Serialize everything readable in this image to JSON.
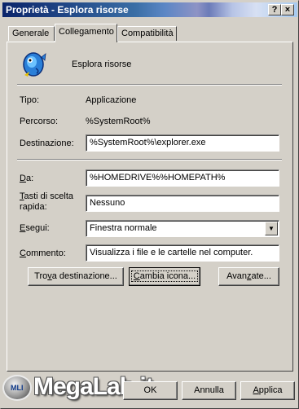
{
  "window": {
    "title": "Proprietà - Esplora risorse",
    "help_button": "?",
    "close_button": "×"
  },
  "tabs": [
    {
      "label": "Generale"
    },
    {
      "label": "Collegamento"
    },
    {
      "label": "Compatibilità"
    }
  ],
  "active_tab": "Collegamento",
  "app": {
    "icon": "explorer-fish-icon",
    "name": "Esplora risorse"
  },
  "info": {
    "type_label": "Tipo:",
    "type_value": "Applicazione",
    "path_label": "Percorso:",
    "path_value": "%SystemRoot%"
  },
  "fields": {
    "destination_label": "Destinazione:",
    "destination_value": "%SystemRoot%\\explorer.exe",
    "start_in_label_a": "D",
    "start_in_label_b": "a:",
    "start_in_value": "%HOMEDRIVE%%HOMEPATH%",
    "hotkey_label_a": "T",
    "hotkey_label_b": "asti di scelta",
    "hotkey_label_c": "rapida:",
    "hotkey_value": "Nessuno",
    "run_label_a": "E",
    "run_label_b": "segui:",
    "run_value": "Finestra normale",
    "comment_label_a": "C",
    "comment_label_b": "ommento:",
    "comment_value": "Visualizza i file e le cartelle nel computer."
  },
  "buttons": {
    "find_target_a": "Tro",
    "find_target_u": "v",
    "find_target_b": "a destinazione...",
    "change_icon_a": "",
    "change_icon_u": "C",
    "change_icon_b": "ambia icona...",
    "advanced_a": "Avan",
    "advanced_u": "z",
    "advanced_b": "ate...",
    "ok": "OK",
    "cancel": "Annulla",
    "apply_a": "",
    "apply_u": "A",
    "apply_b": "pplica"
  },
  "watermark": {
    "text": "MegaLab.it",
    "badge": "MLI"
  }
}
